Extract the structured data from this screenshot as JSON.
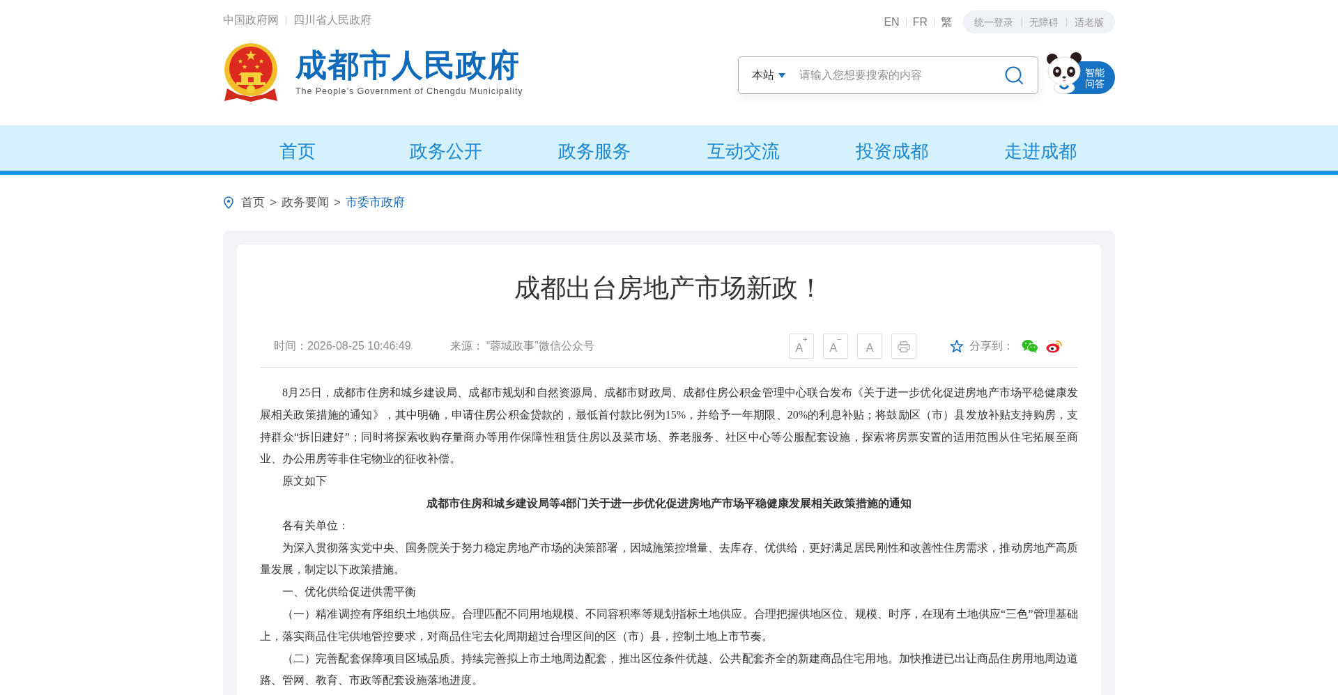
{
  "header": {
    "top_links": [
      "中国政府网",
      "四川省人民政府"
    ],
    "site_title": "成都市人民政府",
    "site_subtitle": "The People’s Government of Chengdu Municipality",
    "languages": [
      "EN",
      "FR",
      "繁"
    ],
    "utility_links": [
      "统一登录",
      "无障碍",
      "适老版"
    ],
    "search": {
      "scope": "本站",
      "placeholder": "请输入您想要搜索的内容"
    },
    "assistant": {
      "label": "智能问答"
    }
  },
  "nav": {
    "items": [
      {
        "label": "首页",
        "selected": false
      },
      {
        "label": "政务公开",
        "selected": false
      },
      {
        "label": "政务服务",
        "selected": false
      },
      {
        "label": "互动交流",
        "selected": false
      },
      {
        "label": "投资成都",
        "selected": false
      },
      {
        "label": "走进成都",
        "selected": false
      }
    ]
  },
  "breadcrumb": [
    {
      "kind": "link",
      "label": "首页",
      "current": false
    },
    {
      "kind": "separator",
      "label": ">",
      "current": false
    },
    {
      "kind": "link",
      "label": "政务要闻",
      "current": false
    },
    {
      "kind": "separator",
      "label": ">",
      "current": false
    },
    {
      "kind": "link",
      "label": "市委市政府",
      "current": true
    }
  ],
  "article": {
    "title": "成都出台房地产市场新政！",
    "time": "时间：2026-08-25 10:46:49",
    "source": "来源： “蓉城政事”微信公众号",
    "font_buttons": [
      "A$^{+}$",
      "A$^{−}$",
      "A"
    ],
    "share_label": "分享到：",
    "body": [
      {
        "kind": "paragraph",
        "text": "8月25日，成都市住房和城乡建设局、成都市规划和自然资源局、成都市财政局、成都住房公积金管理中心联合发布《关于进一步优化促进房地产市场平稳健康发展相关政策措施的通知》，其中明确，申请住房公积金贷款的，最低首付款比例为15%，并给予一年期限、20%的利息补贴；将鼓励区（市）县发放补贴支持购房，支持群众“拆旧建好”；同时将探索收购存量商办等用作保障性租赁住房以及菜市场、养老服务、社区中心等公服配套设施，探索将房票安置的适用范围从住宅拓展至商业、办公用房等非住宅物业的征收补偿。"
      },
      {
        "kind": "paragraph",
        "text": "原文如下"
      },
      {
        "kind": "heading",
        "text": "成都市住房和城乡建设局等4部门关于进一步优化促进房地产市场平稳健康发展相关政策措施的通知"
      },
      {
        "kind": "paragraph",
        "text": "各有关单位："
      },
      {
        "kind": "paragraph",
        "text": "为深入贯彻落实党中央、国务院关于努力稳定房地产市场的决策部署，因城施策控增量、去库存、优供给，更好满足居民刚性和改善性住房需求，推动房地产高质量发展，制定以下政策措施。"
      },
      {
        "kind": "paragraph",
        "text": "一、优化供给促进供需平衡"
      },
      {
        "kind": "paragraph",
        "text": "（一）精准调控有序组织土地供应。合理匹配不同用地规模、不同容积率等规划指标土地供应。合理把握供地区位、规模、时序，在现有土地供应“三色”管理基础上，落实商品住宅供地管控要求，对商品住宅去化周期超过合理区间的区（市）县，控制土地上市节奏。"
      },
      {
        "kind": "paragraph",
        "text": "（二）完善配套保障项目区域品质。持续完善拟上市土地周边配套，推出区位条件优越、公共配套齐全的新建商品住宅用地。加快推进已出让商品住房用地周边道路、管网、教育、市政等配套设施落地进度。"
      }
    ]
  }
}
